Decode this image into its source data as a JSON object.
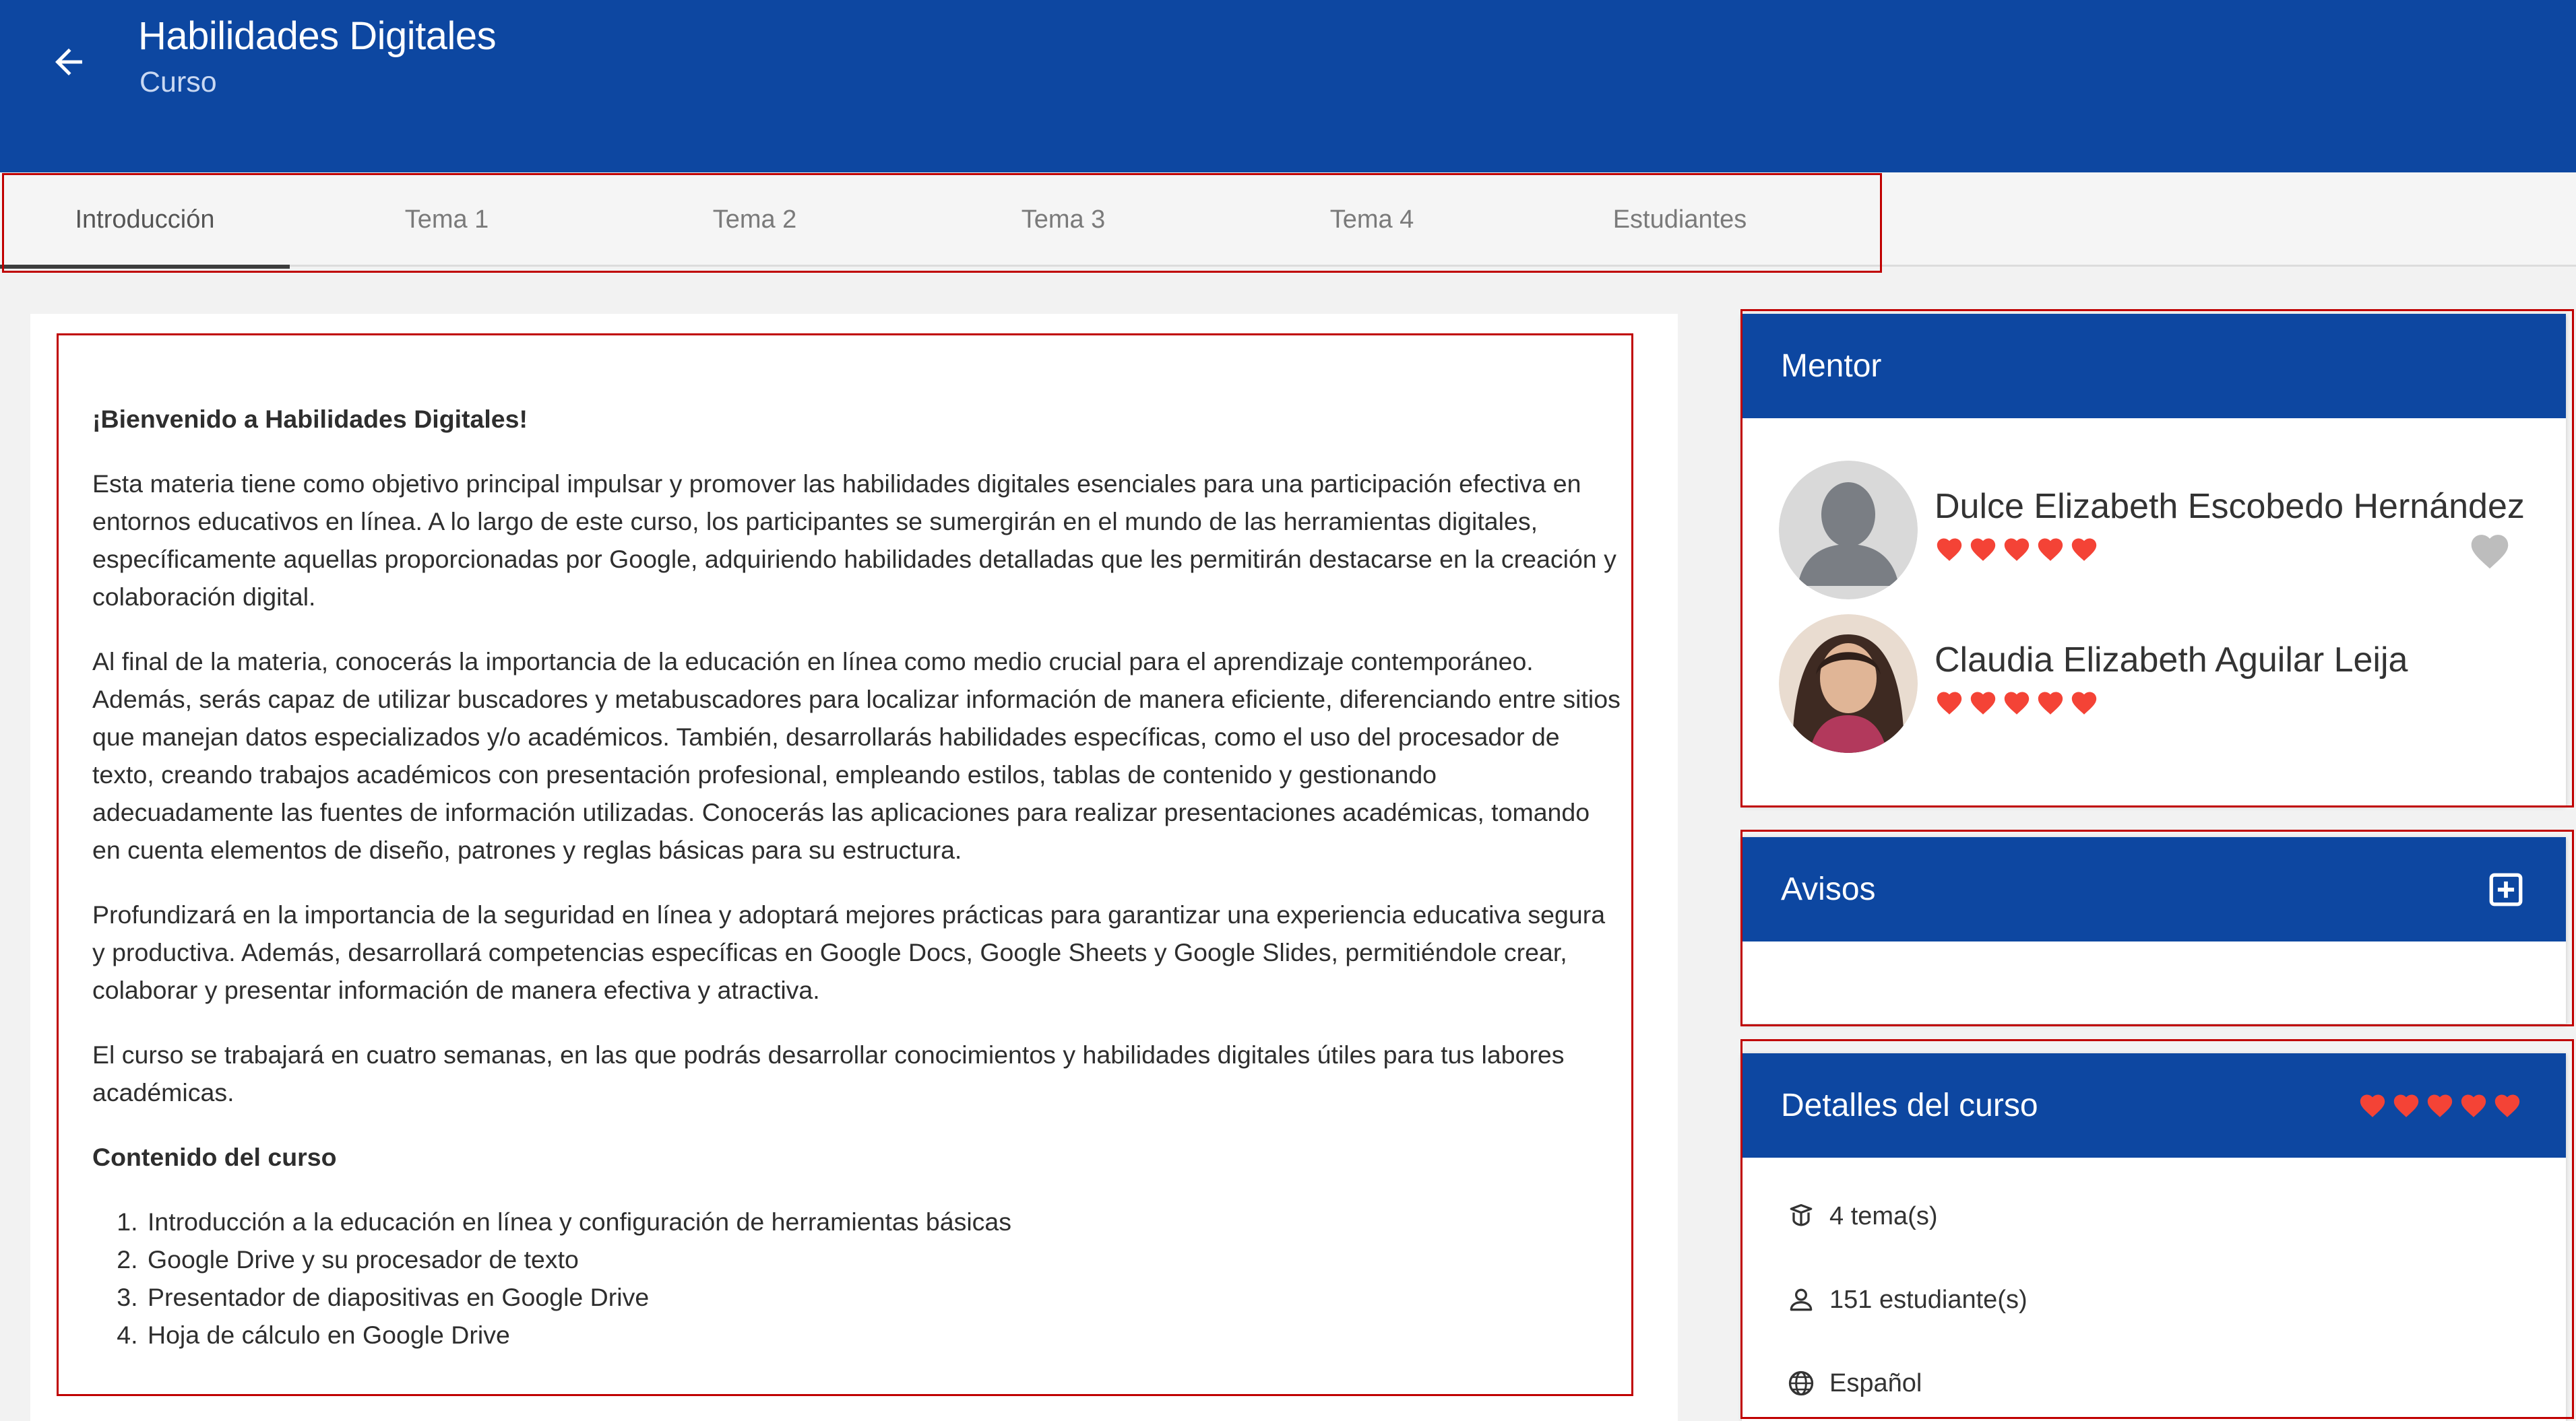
{
  "header": {
    "title": "Habilidades Digitales",
    "subtitle": "Curso",
    "back_icon": "arrow-left-icon",
    "background": "#0d47a1"
  },
  "tabs": [
    {
      "label": "Introducción",
      "active": true
    },
    {
      "label": "Tema 1",
      "active": false
    },
    {
      "label": "Tema 2",
      "active": false
    },
    {
      "label": "Tema 3",
      "active": false
    },
    {
      "label": "Tema 4",
      "active": false
    },
    {
      "label": "Estudiantes",
      "active": false
    }
  ],
  "intro": {
    "welcome": "¡Bienvenido a Habilidades Digitales!",
    "p1": "Esta materia tiene como objetivo principal impulsar y promover las habilidades digitales esenciales para una participación efectiva en entornos educativos en línea. A lo largo de este curso, los participantes se sumergirán en el mundo de las herramientas digitales, específicamente aquellas proporcionadas por Google, adquiriendo habilidades detalladas que les permitirán destacarse en la creación y colaboración digital.",
    "p2": "Al final de la materia, conocerás la importancia de la educación en línea como medio crucial para el aprendizaje contemporáneo. Además, serás capaz de utilizar buscadores y metabuscadores para localizar información de manera eficiente, diferenciando entre sitios que manejan datos especializados y/o académicos. También, desarrollarás habilidades específicas, como el uso del procesador de texto, creando trabajos académicos con presentación profesional, empleando estilos, tablas de contenido y gestionando adecuadamente las fuentes de información utilizadas. Conocerás las aplicaciones para realizar presentaciones académicas, tomando en cuenta elementos de diseño, patrones y reglas básicas para su estructura.",
    "p3": "Profundizará en la importancia de la seguridad en línea y adoptará mejores prácticas para garantizar una experiencia educativa segura y productiva. Además, desarrollará competencias específicas en Google Docs, Google Sheets y Google Slides, permitiéndole crear, colaborar y presentar información de manera efectiva y atractiva.",
    "p4": "El curso se trabajará en cuatro semanas, en las que podrás desarrollar conocimientos y habilidades digitales útiles para tus labores académicas.",
    "contents_heading": "Contenido del curso",
    "contents": [
      "Introducción a la educación en línea y configuración de herramientas básicas",
      "Google Drive y su procesador de texto",
      "Presentador de diapositivas en Google Drive",
      "Hoja de cálculo en Google Drive"
    ]
  },
  "mentor_panel": {
    "title": "Mentor",
    "mentors": [
      {
        "name": "Dulce Elizabeth Escobedo Hernández",
        "rating": 5,
        "avatar": "default-person-avatar"
      },
      {
        "name": "Claudia Elizabeth Aguilar Leija",
        "rating": 5,
        "avatar": "photo-avatar"
      }
    ],
    "favorite_icon": "heart-outline-icon"
  },
  "notices_panel": {
    "title": "Avisos",
    "add_icon": "plus-square-icon"
  },
  "details_panel": {
    "title": "Detalles del curso",
    "rating": 5,
    "topics": "4 tema(s)",
    "students": "151 estudiante(s)",
    "language": "Español",
    "icons": [
      "book-icon",
      "person-icon",
      "globe-icon"
    ]
  },
  "colors": {
    "brand_blue": "#0d47a1",
    "heart_red": "#f44336",
    "outline_red": "#c00000"
  }
}
